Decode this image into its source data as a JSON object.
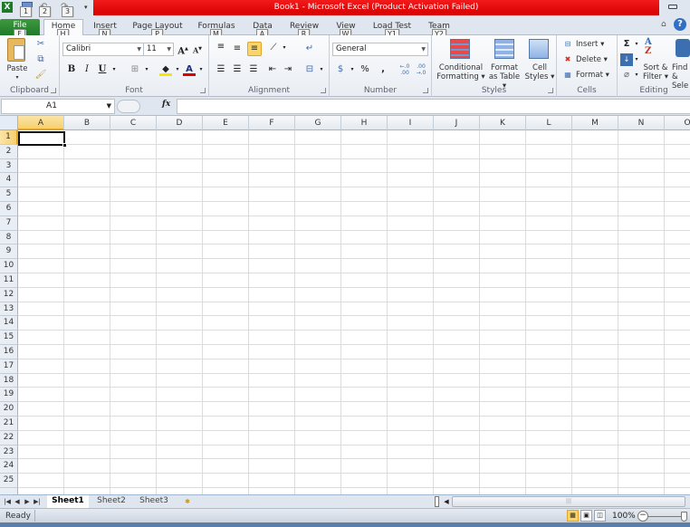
{
  "window": {
    "title": "Book1  -  Microsoft Excel (Product Activation Failed)",
    "quick_access": [
      {
        "name": "save",
        "keytip": "1"
      },
      {
        "name": "undo",
        "keytip": "2"
      },
      {
        "name": "redo",
        "keytip": "3"
      }
    ]
  },
  "ribbon_tabs": [
    {
      "label": "File",
      "keytip": "F",
      "active": false
    },
    {
      "label": "Home",
      "keytip": "H",
      "active": true
    },
    {
      "label": "Insert",
      "keytip": "N",
      "active": false
    },
    {
      "label": "Page Layout",
      "keytip": "P",
      "active": false
    },
    {
      "label": "Formulas",
      "keytip": "M",
      "active": false
    },
    {
      "label": "Data",
      "keytip": "A",
      "active": false
    },
    {
      "label": "Review",
      "keytip": "R",
      "active": false
    },
    {
      "label": "View",
      "keytip": "W",
      "active": false
    },
    {
      "label": "Load Test",
      "keytip": "Y1",
      "active": false
    },
    {
      "label": "Team",
      "keytip": "Y2",
      "active": false
    }
  ],
  "ribbon": {
    "clipboard": {
      "label": "Clipboard",
      "paste": "Paste"
    },
    "font": {
      "label": "Font",
      "font_name": "Calibri",
      "font_size": "11",
      "bold": "B",
      "italic": "I",
      "underline": "U"
    },
    "alignment": {
      "label": "Alignment"
    },
    "number": {
      "label": "Number",
      "format": "General",
      "percent": "%",
      "comma": ",",
      "inc_decimal": "+.0\n.00",
      "dec_decimal": ".00\n+.0"
    },
    "styles": {
      "label": "Styles",
      "conditional_formatting": [
        "Conditional",
        "Formatting ▾"
      ],
      "format_as_table": [
        "Format",
        "as Table ▾"
      ],
      "cell_styles": [
        "Cell",
        "Styles ▾"
      ]
    },
    "cells": {
      "label": "Cells",
      "insert": "Insert ▾",
      "delete": "Delete ▾",
      "format": "Format ▾"
    },
    "editing": {
      "label": "Editing",
      "sort_filter": [
        "Sort &",
        "Filter ▾"
      ],
      "find_select": [
        "Find &",
        "Sele"
      ]
    }
  },
  "formula_bar": {
    "name_box": "A1",
    "fx": "fx",
    "value": ""
  },
  "grid": {
    "columns": [
      "A",
      "B",
      "C",
      "D",
      "E",
      "F",
      "G",
      "H",
      "I",
      "J",
      "K",
      "L",
      "M",
      "N",
      "O"
    ],
    "rows": [
      "1",
      "2",
      "3",
      "4",
      "5",
      "6",
      "7",
      "8",
      "9",
      "10",
      "11",
      "12",
      "13",
      "14",
      "15",
      "16",
      "17",
      "18",
      "19",
      "20",
      "21",
      "22",
      "23",
      "24",
      "25"
    ],
    "active_cell": "A1"
  },
  "sheets": [
    {
      "label": "Sheet1",
      "active": true
    },
    {
      "label": "Sheet2",
      "active": false
    },
    {
      "label": "Sheet3",
      "active": false
    }
  ],
  "status": {
    "text": "Ready",
    "zoom": "100%"
  },
  "colors": {
    "title_bar": "#e00000",
    "file_tab": "#2a832f",
    "selection_highlight": "#f7cf6d"
  }
}
